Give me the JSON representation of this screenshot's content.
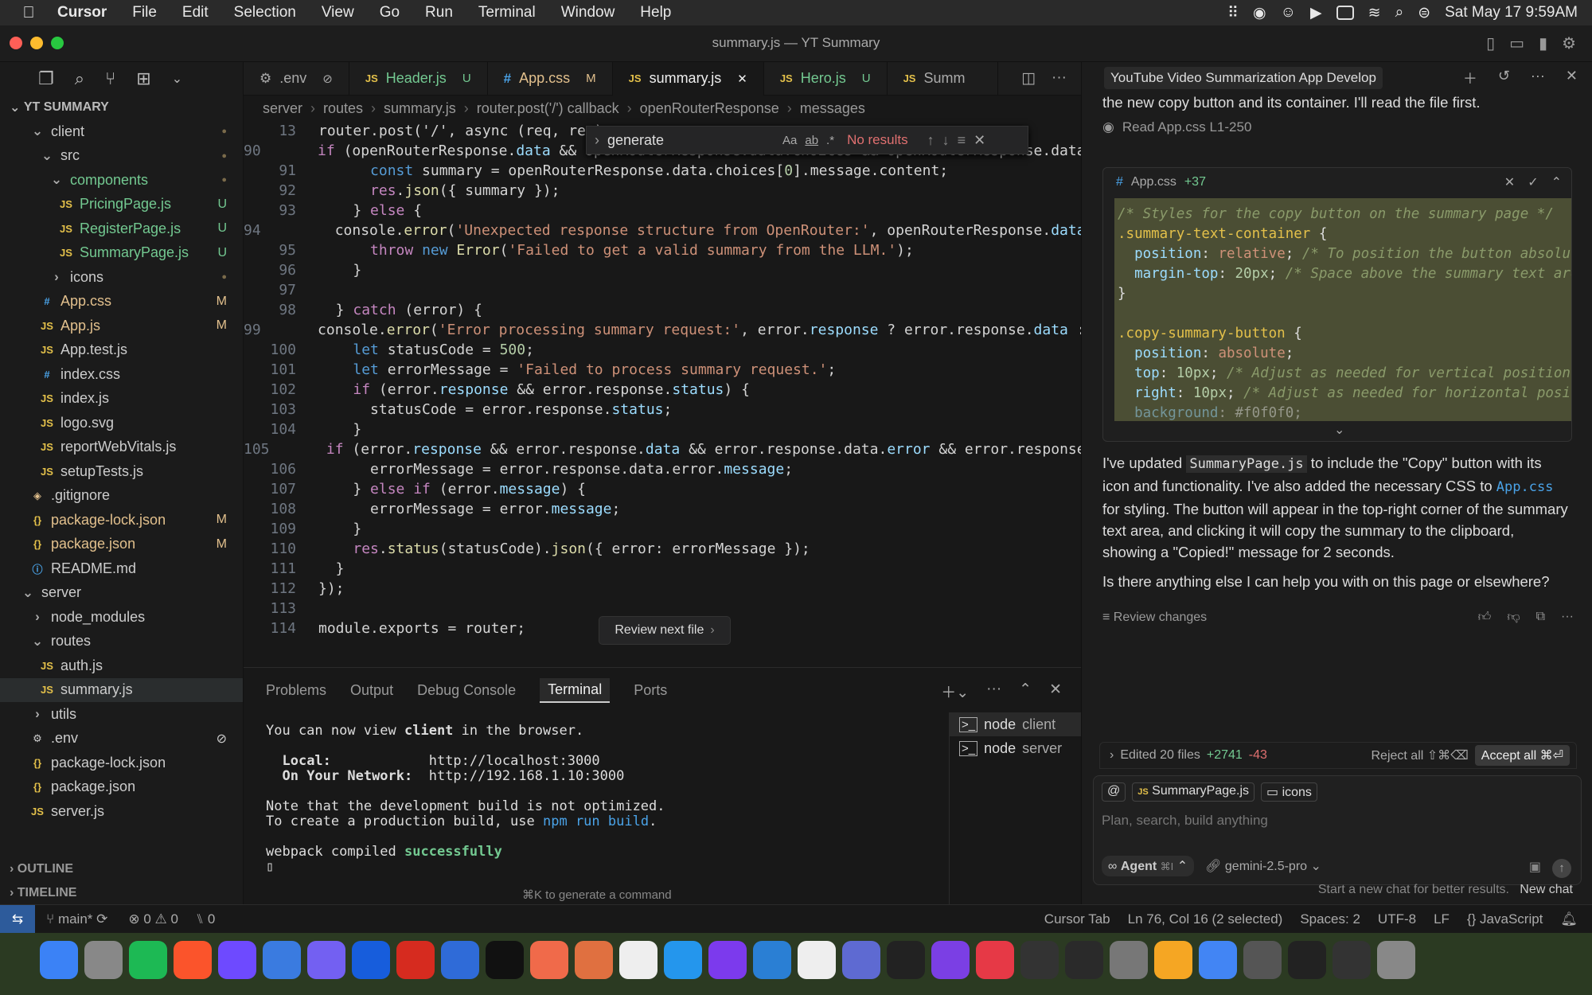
{
  "menubar": {
    "app": "Cursor",
    "items": [
      "File",
      "Edit",
      "Selection",
      "View",
      "Go",
      "Run",
      "Terminal",
      "Window",
      "Help"
    ],
    "datetime": "Sat May 17  9:59AM"
  },
  "window": {
    "title": "summary.js — YT Summary"
  },
  "sidebar": {
    "project": "YT SUMMARY",
    "outline": "OUTLINE",
    "timeline": "TIMELINE",
    "tree": [
      {
        "label": "client",
        "type": "folder",
        "depth": 1,
        "status": "●",
        "open": true
      },
      {
        "label": "src",
        "type": "folder",
        "depth": 2,
        "status": "●",
        "open": true
      },
      {
        "label": "components",
        "type": "folder",
        "depth": 3,
        "status": "●",
        "open": true,
        "color": "#73c991"
      },
      {
        "label": "PricingPage.js",
        "type": "js",
        "depth": 4,
        "status": "U"
      },
      {
        "label": "RegisterPage.js",
        "type": "js",
        "depth": 4,
        "status": "U"
      },
      {
        "label": "SummaryPage.js",
        "type": "js",
        "depth": 4,
        "status": "U"
      },
      {
        "label": "icons",
        "type": "folder",
        "depth": 3,
        "status": "●",
        "open": false
      },
      {
        "label": "App.css",
        "type": "css",
        "depth": 2,
        "status": "M"
      },
      {
        "label": "App.js",
        "type": "js",
        "depth": 2,
        "status": "M"
      },
      {
        "label": "App.test.js",
        "type": "js",
        "depth": 2,
        "status": ""
      },
      {
        "label": "index.css",
        "type": "css",
        "depth": 2,
        "status": ""
      },
      {
        "label": "index.js",
        "type": "js",
        "depth": 2,
        "status": ""
      },
      {
        "label": "logo.svg",
        "type": "svg",
        "depth": 2,
        "status": ""
      },
      {
        "label": "reportWebVitals.js",
        "type": "js",
        "depth": 2,
        "status": ""
      },
      {
        "label": "setupTests.js",
        "type": "js",
        "depth": 2,
        "status": ""
      },
      {
        "label": ".gitignore",
        "type": "git",
        "depth": 1,
        "status": ""
      },
      {
        "label": "package-lock.json",
        "type": "json",
        "depth": 1,
        "status": "M"
      },
      {
        "label": "package.json",
        "type": "json",
        "depth": 1,
        "status": "M"
      },
      {
        "label": "README.md",
        "type": "info",
        "depth": 1,
        "status": ""
      },
      {
        "label": "server",
        "type": "folder",
        "depth": 0,
        "status": "",
        "open": true
      },
      {
        "label": "node_modules",
        "type": "folder",
        "depth": 1,
        "status": "",
        "open": false
      },
      {
        "label": "routes",
        "type": "folder",
        "depth": 1,
        "status": "",
        "open": true
      },
      {
        "label": "auth.js",
        "type": "js",
        "depth": 2,
        "status": ""
      },
      {
        "label": "summary.js",
        "type": "js",
        "depth": 2,
        "status": "",
        "selected": true
      },
      {
        "label": "utils",
        "type": "folder",
        "depth": 1,
        "status": "",
        "open": false
      },
      {
        "label": ".env",
        "type": "gear",
        "depth": 1,
        "status": "⊘"
      },
      {
        "label": "package-lock.json",
        "type": "json",
        "depth": 1,
        "status": ""
      },
      {
        "label": "package.json",
        "type": "json",
        "depth": 1,
        "status": ""
      },
      {
        "label": "server.js",
        "type": "js",
        "depth": 1,
        "status": ""
      }
    ]
  },
  "tabs": [
    {
      "icon": "⚙",
      "label": ".env",
      "badge": "⊘",
      "active": false
    },
    {
      "icon": "JS",
      "label": "Header.js",
      "badge": "U",
      "active": false
    },
    {
      "icon": "#",
      "label": "App.css",
      "badge": "M",
      "active": false
    },
    {
      "icon": "JS",
      "label": "summary.js",
      "badge": "✕",
      "active": true
    },
    {
      "icon": "JS",
      "label": "Hero.js",
      "badge": "U",
      "active": false
    },
    {
      "icon": "JS",
      "label": "Summ",
      "badge": "",
      "active": false
    }
  ],
  "breadcrumb": [
    "server",
    "routes",
    "summary.js",
    "router.post('/') callback",
    "openRouterResponse",
    "messages"
  ],
  "find": {
    "query": "generate",
    "result": "No results"
  },
  "code": [
    {
      "n": "13",
      "h": "router.post('/', async (req, res)"
    },
    {
      "n": "90",
      "h": "    <span class='k'>if</span> (openRouterResponse.<span class='v'>data</span> &amp;&amp; openRouterResponse.data.choices &amp;&amp; openRouterResponse.data.ch"
    },
    {
      "n": "91",
      "h": "      <span class='b'>const</span> summary = openRouterResponse.data.choices[<span class='n'>0</span>].message.content;"
    },
    {
      "n": "92",
      "h": "      <span class='k'>res</span>.<span class='f'>json</span>({ summary });"
    },
    {
      "n": "93",
      "h": "    } <span class='k'>else</span> {"
    },
    {
      "n": "94",
      "h": "      console.<span class='f'>error</span>(<span class='s'>'Unexpected response structure from OpenRouter:'</span>, openRouterResponse.<span class='v'>data</span>);"
    },
    {
      "n": "95",
      "h": "      <span class='k'>throw</span> <span class='b'>new</span> <span class='f'>Error</span>(<span class='s'>'Failed to get a valid summary from the LLM.'</span>);"
    },
    {
      "n": "96",
      "h": "    }"
    },
    {
      "n": "97",
      "h": ""
    },
    {
      "n": "98",
      "h": "  } <span class='k'>catch</span> (error) {"
    },
    {
      "n": "99",
      "h": "    console.<span class='f'>error</span>(<span class='s'>'Error processing summary request:'</span>, error.<span class='v'>response</span> ? error.response.<span class='v'>data</span> : er"
    },
    {
      "n": "100",
      "h": "    <span class='b'>let</span> statusCode = <span class='n'>500</span>;"
    },
    {
      "n": "101",
      "h": "    <span class='b'>let</span> errorMessage = <span class='s'>'Failed to process summary request.'</span>;"
    },
    {
      "n": "102",
      "h": "    <span class='k'>if</span> (error.<span class='v'>response</span> &amp;&amp; error.response.<span class='v'>status</span>) {"
    },
    {
      "n": "103",
      "h": "      statusCode = error.response.<span class='v'>status</span>;"
    },
    {
      "n": "104",
      "h": "    }"
    },
    {
      "n": "105",
      "h": "    <span class='k'>if</span> (error.<span class='v'>response</span> &amp;&amp; error.response.<span class='v'>data</span> &amp;&amp; error.response.data.<span class='v'>error</span> &amp;&amp; error.response.dat"
    },
    {
      "n": "106",
      "h": "      errorMessage = error.response.data.error.<span class='v'>message</span>;"
    },
    {
      "n": "107",
      "h": "    } <span class='k'>else if</span> (error.<span class='v'>message</span>) {"
    },
    {
      "n": "108",
      "h": "      errorMessage = error.<span class='v'>message</span>;"
    },
    {
      "n": "109",
      "h": "    }"
    },
    {
      "n": "110",
      "h": "    <span class='k'>res</span>.<span class='f'>status</span>(statusCode).<span class='f'>json</span>({ error: errorMessage });"
    },
    {
      "n": "111",
      "h": "  }"
    },
    {
      "n": "112",
      "h": "});"
    },
    {
      "n": "113",
      "h": ""
    },
    {
      "n": "114",
      "h": "module.exports = router;"
    }
  ],
  "review_next": "Review next file",
  "panel": {
    "tabs": [
      "Problems",
      "Output",
      "Debug Console",
      "Terminal",
      "Ports"
    ],
    "active": "Terminal",
    "terminals": [
      {
        "name": "node",
        "arg": "client"
      },
      {
        "name": "node",
        "arg": "server"
      }
    ],
    "hint": "⌘K to generate a command"
  },
  "terminal_output": "You can now view <b>client</b> in the browser.\n\n  <b>Local:</b>            http://localhost:3000\n  <b>On Your Network:</b>  http://192.168.1.10:3000\n\nNote that the development build is not optimized.\nTo create a production build, use <span style='color:#4aa3e8'>npm run build</span>.\n\nwebpack compiled <b style='color:#73c991'>successfully</b>\n▯",
  "chat": {
    "title": "YouTube Video Summarization App Develop",
    "intro": "the new copy button and its container. I'll read the file first.",
    "read_note": "Read App.css L1-250",
    "card_file": "App.css",
    "card_add": "+37",
    "card_code": "<span style='color:#8a9a6a;font-style:italic'>/* Styles for the copy button on the summary page */</span>\n<span style='color:#e3c04a'>.summary-text-container</span> {\n  <span class='v'>position</span>: <span class='s'>relative</span>; <span style='color:#8a9a6a;font-style:italic'>/* To position the button absolutely</span>\n  <span class='v'>margin-top</span>: <span class='n'>20px</span>; <span style='color:#8a9a6a;font-style:italic'>/* Space above the summary text area *</span>\n}\n\n<span style='color:#e3c04a'>.copy-summary-button</span> {\n  <span class='v'>position</span>: <span class='s'>absolute</span>;\n  <span class='v'>top</span>: <span class='n'>10px</span>; <span style='color:#8a9a6a;font-style:italic'>/* Adjust as needed for vertical position */</span>\n  <span class='v'>right</span>: <span class='n'>10px</span>; <span style='color:#8a9a6a;font-style:italic'>/* Adjust as needed for horizontal positio</span>\n  <span class='v' style='opacity:.5'>background</span><span style='opacity:.5'>: #f0f0f0;</span>",
    "msg1_a": "I've updated ",
    "msg1_file": "SummaryPage.js",
    "msg1_b": " to include the \"Copy\" button with its icon and functionality. I've also added the necessary CSS to ",
    "msg1_link": "App.css",
    "msg1_c": " for styling. The button will appear in the top-right corner of the summary text area, and clicking it will copy the summary to the clipboard, showing a \"Copied!\" message for 2 seconds.",
    "msg2": "Is there anything else I can help you with on this page or elsewhere?",
    "review": "Review changes",
    "edited": "Edited 20 files",
    "added": "+2741",
    "removed": "-43",
    "reject": "Reject all ⇧⌘⌫",
    "accept": "Accept all ⌘⏎",
    "chips": [
      "SummaryPage.js",
      "icons"
    ],
    "placeholder": "Plan, search, build anything",
    "mode": "Agent",
    "mode_key": "⌘I",
    "model": "gemini-2.5-pro",
    "footer_hint": "Start a new chat for better results.",
    "new_chat": "New chat"
  },
  "status": {
    "branch": "main*",
    "errors": "0",
    "warnings": "0",
    "ports": "0",
    "tab": "Cursor Tab",
    "pos": "Ln 76, Col 16 (2 selected)",
    "spaces": "Spaces: 2",
    "enc": "UTF-8",
    "eol": "LF",
    "lang": "JavaScript"
  },
  "dock": [
    "finder",
    "launchpad",
    "spotify",
    "brave",
    "arc",
    "mail",
    "viber",
    "bitwarden",
    "acrobat",
    "wireshark",
    "terminal",
    "app",
    "claude",
    "notion",
    "docker",
    "obsidian",
    "vscode",
    "w",
    "linear",
    "cursor",
    "infinity",
    "davinci",
    "obs",
    "activity",
    "system-settings",
    "sheets",
    "chrome",
    "calculator",
    "airplane",
    "monitor",
    "trash"
  ]
}
